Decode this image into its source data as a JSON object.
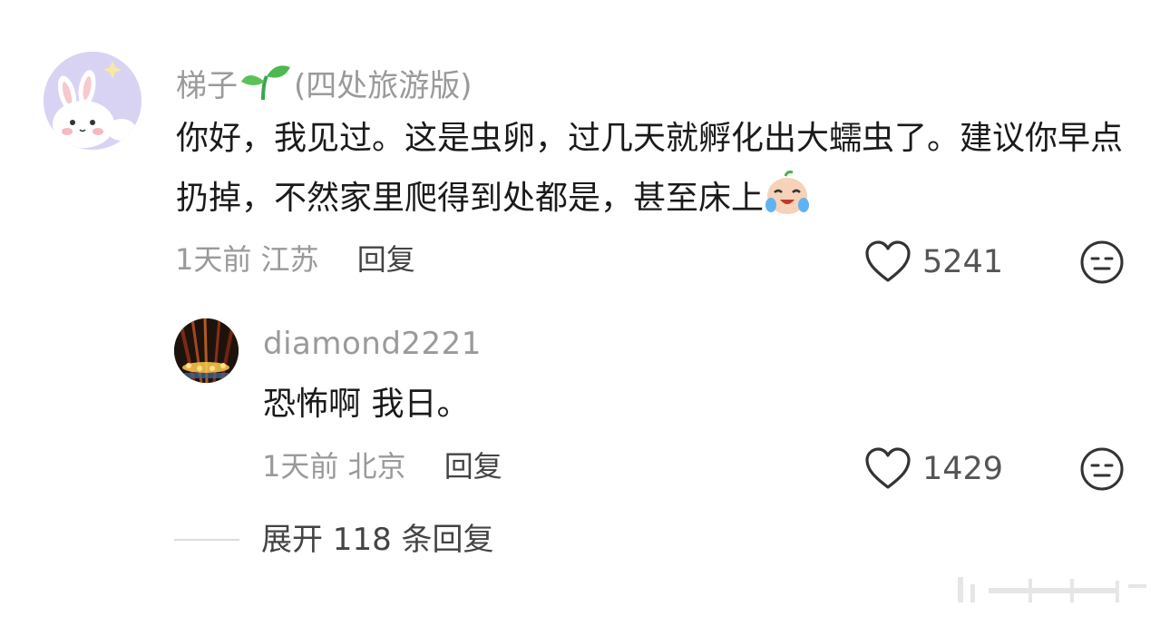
{
  "comment": {
    "username": "梯子",
    "username_suffix": "(四处旅游版)",
    "text": "你好，我见过。这是虫卵，过几天就孵化出大蠕虫了。建议你早点扔掉，不然家里爬得到处都是，甚至床上",
    "time": "1天前",
    "location": "江苏",
    "reply_label": "回复",
    "likes": "5241"
  },
  "reply": {
    "username": "diamond2221",
    "text": "恐怖啊 我日。",
    "time": "1天前",
    "location": "北京",
    "reply_label": "回复",
    "likes": "1429"
  },
  "expand": {
    "label": "展开 118 条回复"
  },
  "icons": {
    "like": "heart-outline-icon",
    "dislike": "meh-face-icon",
    "sprout": "sprout-emoji",
    "crying": "crying-laughing-emoji"
  }
}
